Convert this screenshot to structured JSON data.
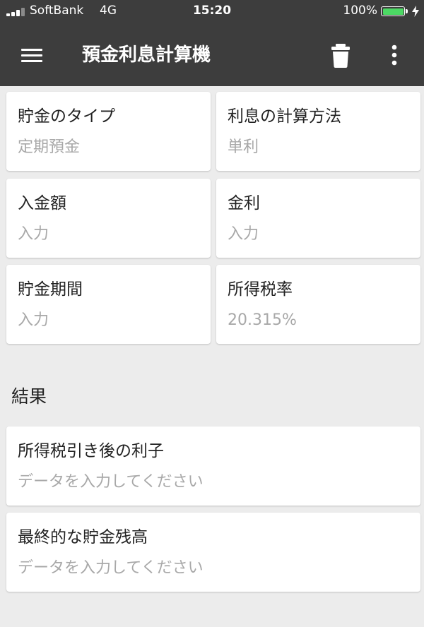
{
  "status_bar": {
    "carrier": "SoftBank",
    "network": "4G",
    "time": "15:20",
    "battery_percent": "100%",
    "battery_level": 1.0,
    "signal_bars_filled": 3,
    "signal_bars_total": 4
  },
  "app_bar": {
    "title": "預金利息計算機",
    "menu_icon": "hamburger-menu-icon",
    "delete_icon": "trash-icon",
    "more_icon": "more-vert-icon"
  },
  "inputs": {
    "savings_type": {
      "label": "貯金のタイプ",
      "value": "定期預金"
    },
    "interest_method": {
      "label": "利息の計算方法",
      "value": "単利"
    },
    "deposit_amount": {
      "label": "入金額",
      "placeholder": "入力"
    },
    "interest_rate": {
      "label": "金利",
      "placeholder": "入力"
    },
    "savings_period": {
      "label": "貯金期間",
      "placeholder": "入力"
    },
    "tax_rate": {
      "label": "所得税率",
      "value": "20.315%"
    }
  },
  "results": {
    "title": "結果",
    "after_tax_interest": {
      "label": "所得税引き後の利子",
      "value": "データを入力してください"
    },
    "final_balance": {
      "label": "最終的な貯金残高",
      "value": "データを入力してください"
    }
  },
  "colors": {
    "bar_background": "#3d3d3d",
    "page_background": "#ececec",
    "card_background": "#ffffff",
    "label_text": "#222222",
    "hint_text": "#a8a8a8",
    "battery_green": "#4cd964",
    "signal_dim": "#8a8a8a"
  }
}
